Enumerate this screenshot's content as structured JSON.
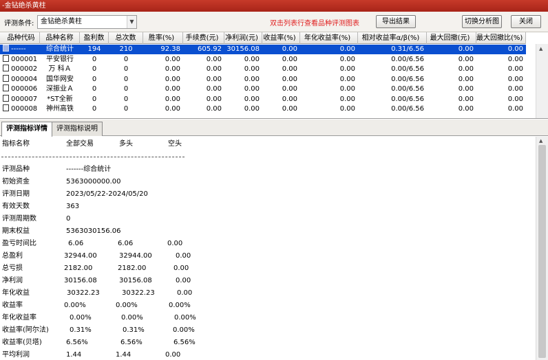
{
  "window": {
    "title": "-金钻绝杀黄柱"
  },
  "toolbar": {
    "label": "评测条件:",
    "select_value": "金钻绝杀黄柱",
    "hint": "双击列表行查看品种评测图表",
    "export_label": "导出结果",
    "switch_label": "切换分析图",
    "close_label": "关闭"
  },
  "grid": {
    "columns": [
      "品种代码",
      "品种名称",
      "盈利数",
      "总次数",
      "胜率(%)",
      "手续费(元)",
      "净利润(元)",
      "收益率(%)",
      "年化收益率(%)",
      "相对收益率α/β(%)",
      "最大回撤(元)",
      "最大回撤比(%)"
    ],
    "rows": [
      [
        "------",
        "综合统计",
        "194",
        "210",
        "92.38",
        "605.92",
        "30156.08",
        "0.00",
        "0.00",
        "0.31/6.56",
        "0.00",
        "0.00"
      ],
      [
        "000001",
        "平安银行",
        "0",
        "0",
        "0.00",
        "0.00",
        "0.00",
        "0.00",
        "0.00",
        "0.00/6.56",
        "0.00",
        "0.00"
      ],
      [
        "000002",
        "万 科Ａ",
        "0",
        "0",
        "0.00",
        "0.00",
        "0.00",
        "0.00",
        "0.00",
        "0.00/6.56",
        "0.00",
        "0.00"
      ],
      [
        "000004",
        "国华网安",
        "0",
        "0",
        "0.00",
        "0.00",
        "0.00",
        "0.00",
        "0.00",
        "0.00/6.56",
        "0.00",
        "0.00"
      ],
      [
        "000006",
        "深振业Ａ",
        "0",
        "0",
        "0.00",
        "0.00",
        "0.00",
        "0.00",
        "0.00",
        "0.00/6.56",
        "0.00",
        "0.00"
      ],
      [
        "000007",
        "*ST全新",
        "0",
        "0",
        "0.00",
        "0.00",
        "0.00",
        "0.00",
        "0.00",
        "0.00/6.56",
        "0.00",
        "0.00"
      ],
      [
        "000008",
        "神州高铁",
        "0",
        "0",
        "0.00",
        "0.00",
        "0.00",
        "0.00",
        "0.00",
        "0.00/6.56",
        "0.00",
        "0.00"
      ]
    ]
  },
  "tabs": [
    "评测指标详情",
    "评测指标说明"
  ],
  "detail": {
    "header": [
      "指标名称",
      "全部交易",
      "多头",
      "空头"
    ],
    "lines": [
      [
        "评测品种",
        "-------综合统计",
        "",
        ""
      ],
      [
        "初始资金",
        "5363000000.00",
        "",
        ""
      ],
      [
        "评测日期",
        "2023/05/22-2024/05/20",
        "",
        ""
      ],
      [
        "有效天数",
        "363",
        "",
        ""
      ],
      [
        "评测周期数",
        "0",
        "",
        ""
      ],
      [
        "期末权益",
        "5363030156.06",
        "",
        ""
      ],
      [
        "盈亏时间比",
        "6.06",
        "6.06",
        "0.00"
      ],
      [
        "总盈利",
        "32944.00",
        "32944.00",
        "0.00"
      ],
      [
        "总亏损",
        "2182.00",
        "2182.00",
        "0.00"
      ],
      [
        "净利润",
        "30156.08",
        "30156.08",
        "0.00"
      ],
      [
        "年化收益",
        "30322.23",
        "30322.23",
        "0.00"
      ],
      [
        "收益率",
        "0.00%",
        "0.00%",
        "0.00%"
      ],
      [
        "年化收益率",
        "0.00%",
        "0.00%",
        "0.00%"
      ],
      [
        "收益率(阿尔法)",
        "0.31%",
        "0.31%",
        "0.00%"
      ],
      [
        "收益率(贝塔)",
        "6.56%",
        "6.56%",
        "6.56%"
      ],
      [
        "平均利润",
        "1.44",
        "1.44",
        "0.00"
      ]
    ]
  }
}
